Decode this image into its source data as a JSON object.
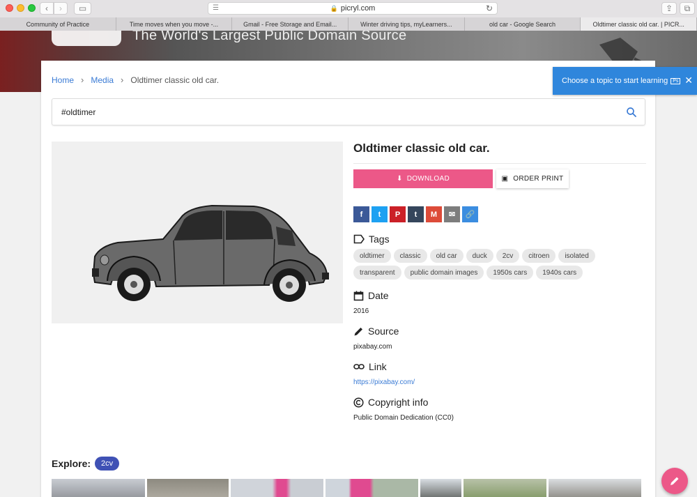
{
  "browser": {
    "url": "picryl.com",
    "tabs": [
      {
        "label": "Community of Practice"
      },
      {
        "label": "Time moves when you move -..."
      },
      {
        "label": "Gmail - Free Storage and Email..."
      },
      {
        "label": "Winter driving tips, myLearners..."
      },
      {
        "label": "old car - Google Search"
      },
      {
        "label": "Oldtimer classic old car. | PICR..."
      }
    ]
  },
  "hero": {
    "title": "The World's Largest Public Domain Source"
  },
  "breadcrumb": {
    "home": "Home",
    "media": "Media",
    "current": "Oldtimer classic old car."
  },
  "search": {
    "value": "#oldtimer",
    "icon": "search-icon"
  },
  "item": {
    "title": "Oldtimer classic old car.",
    "download_label": "DOWNLOAD",
    "print_label": "ORDER PRINT"
  },
  "social": [
    {
      "name": "facebook",
      "glyph": "f",
      "color": "#3b5998"
    },
    {
      "name": "twitter",
      "glyph": "t",
      "color": "#1da1f2"
    },
    {
      "name": "pinterest",
      "glyph": "P",
      "color": "#cb2027"
    },
    {
      "name": "tumblr",
      "glyph": "t",
      "color": "#35465c"
    },
    {
      "name": "gmail",
      "glyph": "M",
      "color": "#dd4b39"
    },
    {
      "name": "email",
      "glyph": "✉",
      "color": "#7d7d7d"
    },
    {
      "name": "copy-link",
      "glyph": "🔗",
      "color": "#3b8de0"
    }
  ],
  "tags": {
    "heading": "Tags",
    "items": [
      "oldtimer",
      "classic",
      "old car",
      "duck",
      "2cv",
      "citroen",
      "isolated",
      "transparent",
      "public domain images",
      "1950s cars",
      "1940s cars"
    ]
  },
  "date": {
    "heading": "Date",
    "value": "2016"
  },
  "source": {
    "heading": "Source",
    "value": "pixabay.com"
  },
  "link": {
    "heading": "Link",
    "value": "https://pixabay.com/"
  },
  "copyright": {
    "heading": "Copyright info",
    "value": "Public Domain Dedication (CC0)"
  },
  "explore": {
    "label": "Explore:",
    "chip": "2cv"
  },
  "toast": {
    "text": "Choose a topic to start learning",
    "badge": "Ps"
  },
  "colors": {
    "accent": "#ec5888",
    "link": "#3a7bd5",
    "toast": "#2f86dc",
    "explore_chip": "#3f51b5"
  }
}
